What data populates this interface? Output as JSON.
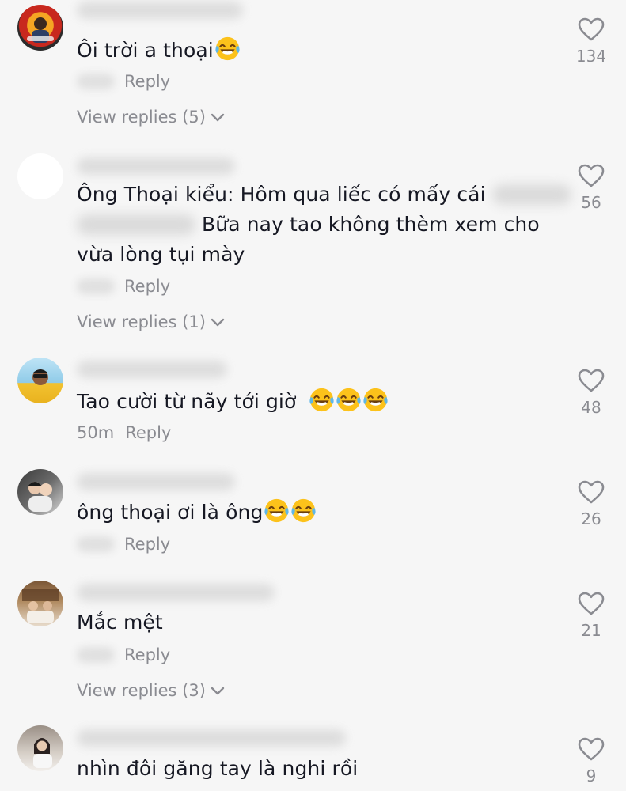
{
  "reply_label": "Reply",
  "comments": [
    {
      "text": "Ôi trời a thoại",
      "emoji": [
        "face-with-tears-of-joy"
      ],
      "likes": "134",
      "view_replies": "View replies (5)"
    },
    {
      "text_line1": "Ông Thoại kiểu: Hôm qua liếc có mấy cái",
      "text_line2": "Bữa nay tao không thèm xem cho",
      "text_line3": "vừa lòng tụi mày",
      "likes": "56",
      "view_replies": "View replies (1)"
    },
    {
      "text": "Tao cười từ nãy tới giờ",
      "emoji": [
        "face-with-tears-of-joy",
        "face-with-tears-of-joy",
        "face-with-tears-of-joy"
      ],
      "time": "50m",
      "likes": "48"
    },
    {
      "text": "ông thoại ơi là ông",
      "emoji": [
        "face-with-tears-of-joy",
        "face-with-tears-of-joy"
      ],
      "likes": "26"
    },
    {
      "text": "Mắc mệt",
      "likes": "21",
      "view_replies": "View replies (3)"
    },
    {
      "text": "nhìn đôi găng tay là nghi rồi",
      "likes": "9"
    }
  ],
  "colors": {
    "background": "#f6f6f6",
    "text": "#161823",
    "secondary_text": "#8a8b91",
    "heart_outline": "#8a8b91"
  }
}
